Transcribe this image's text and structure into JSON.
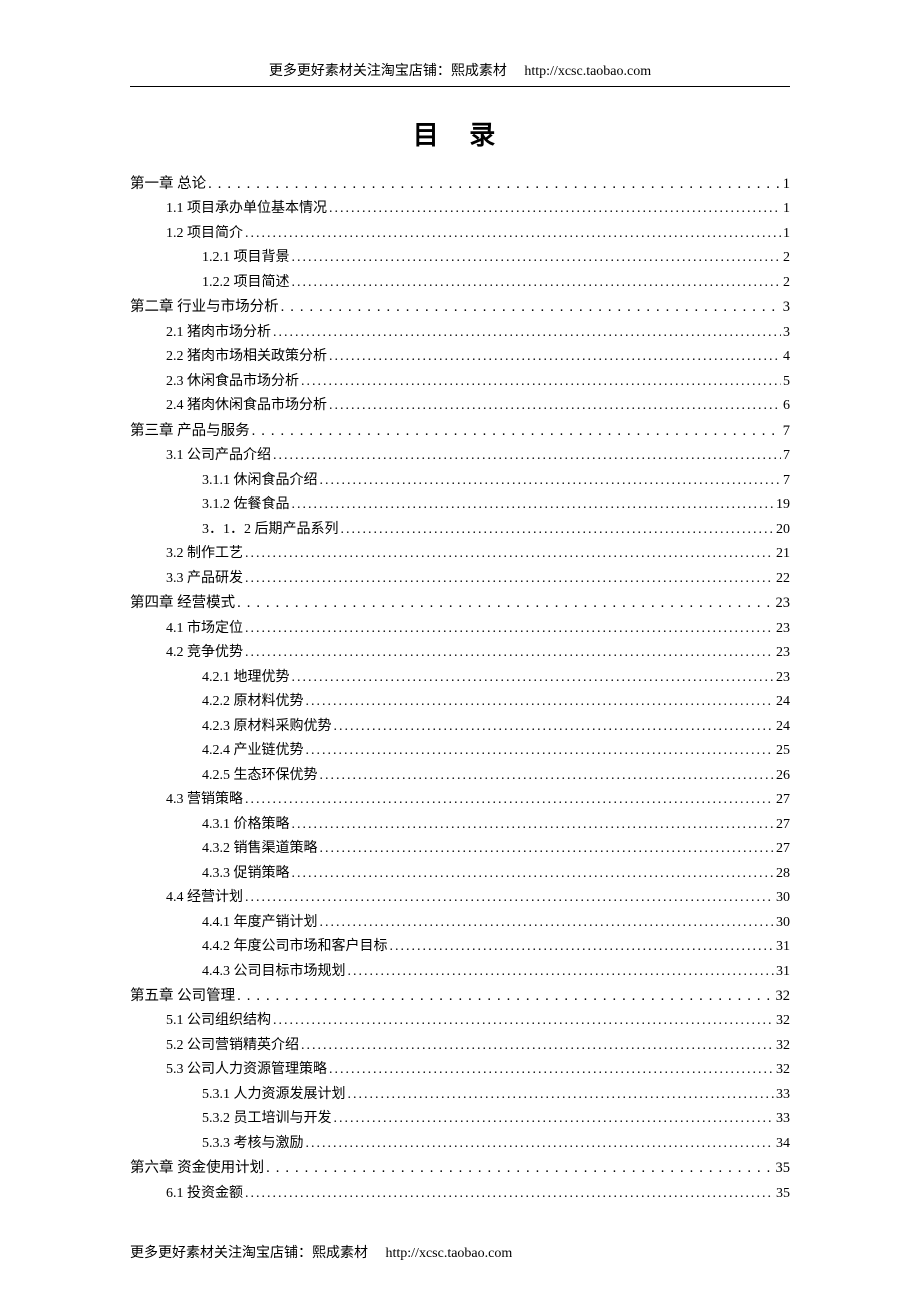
{
  "header": {
    "text": "更多更好素材关注淘宝店铺：熙成素材",
    "url": "http://xcsc.taobao.com"
  },
  "title": "目 录",
  "footer": {
    "text": "更多更好素材关注淘宝店铺：熙成素材",
    "url": "http://xcsc.taobao.com"
  },
  "toc": [
    {
      "level": 0,
      "label": "第一章   总论",
      "page": "1",
      "chapter": true
    },
    {
      "level": 1,
      "label": "1.1 项目承办单位基本情况",
      "page": "1"
    },
    {
      "level": 1,
      "label": "1.2 项目简介",
      "page": "1"
    },
    {
      "level": 2,
      "label": "1.2.1 项目背景",
      "page": "2"
    },
    {
      "level": 2,
      "label": "1.2.2 项目简述",
      "page": "2"
    },
    {
      "level": 0,
      "label": "第二章   行业与市场分析",
      "page": "3",
      "chapter": true
    },
    {
      "level": 1,
      "label": "2.1 猪肉市场分析",
      "page": "3"
    },
    {
      "level": 1,
      "label": "2.2 猪肉市场相关政策分析",
      "page": "4"
    },
    {
      "level": 1,
      "label": "2.3 休闲食品市场分析",
      "page": "5"
    },
    {
      "level": 1,
      "label": "2.4 猪肉休闲食品市场分析",
      "page": "6"
    },
    {
      "level": 0,
      "label": "第三章   产品与服务",
      "page": "7",
      "chapter": true
    },
    {
      "level": 1,
      "label": "3.1 公司产品介绍",
      "page": "7"
    },
    {
      "level": 2,
      "label": "3.1.1 休闲食品介绍",
      "page": "7"
    },
    {
      "level": 2,
      "label": "3.1.2 佐餐食品",
      "page": "19"
    },
    {
      "level": 2,
      "label": "3．1．2 后期产品系列",
      "page": "20"
    },
    {
      "level": 1,
      "label": "3.2 制作工艺",
      "page": "21"
    },
    {
      "level": 1,
      "label": "3.3 产品研发",
      "page": "22"
    },
    {
      "level": 0,
      "label": "第四章   经营模式",
      "page": "23",
      "chapter": true
    },
    {
      "level": 1,
      "label": "4.1 市场定位",
      "page": "23"
    },
    {
      "level": 1,
      "label": "4.2 竞争优势",
      "page": "23"
    },
    {
      "level": 2,
      "label": "4.2.1 地理优势",
      "page": "23"
    },
    {
      "level": 2,
      "label": "4.2.2 原材料优势",
      "page": "24"
    },
    {
      "level": 2,
      "label": "4.2.3 原材料采购优势",
      "page": "24"
    },
    {
      "level": 2,
      "label": "4.2.4 产业链优势",
      "page": "25"
    },
    {
      "level": 2,
      "label": "4.2.5 生态环保优势",
      "page": "26"
    },
    {
      "level": 1,
      "label": "4.3 营销策略",
      "page": "27"
    },
    {
      "level": 2,
      "label": "4.3.1 价格策略",
      "page": "27"
    },
    {
      "level": 2,
      "label": "4.3.2 销售渠道策略",
      "page": "27"
    },
    {
      "level": 2,
      "label": "4.3.3 促销策略",
      "page": "28"
    },
    {
      "level": 1,
      "label": "4.4 经营计划",
      "page": "30"
    },
    {
      "level": 2,
      "label": "4.4.1  年度产销计划",
      "page": "30"
    },
    {
      "level": 2,
      "label": "4.4.2  年度公司市场和客户目标",
      "page": "31"
    },
    {
      "level": 2,
      "label": "4.4.3 公司目标市场规划",
      "page": "31"
    },
    {
      "level": 0,
      "label": "第五章   公司管理",
      "page": "32",
      "chapter": true
    },
    {
      "level": 1,
      "label": "5.1 公司组织结构",
      "page": "32"
    },
    {
      "level": 1,
      "label": "5.2 公司营销精英介绍",
      "page": "32"
    },
    {
      "level": 1,
      "label": "5.3 公司人力资源管理策略",
      "page": "32"
    },
    {
      "level": 2,
      "label": "5.3.1 人力资源发展计划",
      "page": "33"
    },
    {
      "level": 2,
      "label": "5.3.2 员工培训与开发",
      "page": "33"
    },
    {
      "level": 2,
      "label": "5.3.3 考核与激励",
      "page": "34"
    },
    {
      "level": 0,
      "label": "第六章   资金使用计划",
      "page": "35",
      "chapter": true
    },
    {
      "level": 1,
      "label": "6.1 投资金额",
      "page": "35"
    }
  ]
}
